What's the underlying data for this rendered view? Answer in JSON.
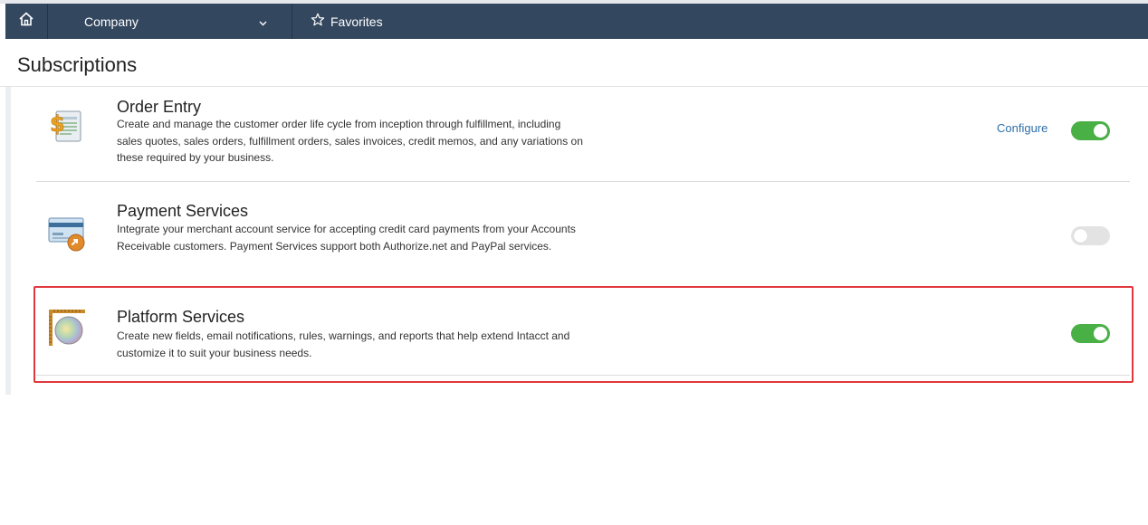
{
  "nav": {
    "home_icon": "home-icon",
    "company_label": "Company",
    "company_chevron_icon": "chevron-down-icon",
    "favorites_icon": "star-outline-icon",
    "favorites_label": "Favorites"
  },
  "page": {
    "title": "Subscriptions"
  },
  "subscriptions": [
    {
      "name": "Order Entry",
      "description": "Create and manage the customer order life cycle from inception through fulfillment, including sales quotes, sales orders, fulfillment orders, sales invoices, credit memos, and any variations on these required by your business.",
      "icon": "order-entry-icon",
      "configure_label": "Configure",
      "enabled": true
    },
    {
      "name": "Payment Services",
      "description": "Integrate your merchant account service for accepting credit card payments from your Accounts Receivable customers. Payment Services support both Authorize.net and PayPal services.",
      "icon": "payment-card-icon",
      "enabled": false
    },
    {
      "name": "Platform Services",
      "description": "Create new fields, email notifications, rules, warnings, and reports that help extend Intacct and customize it to suit your business needs.",
      "icon": "platform-services-icon",
      "enabled": true,
      "highlighted": true
    }
  ],
  "colors": {
    "nav_bg": "#33475f",
    "toggle_on": "#49b046",
    "toggle_off": "#e3e3e3",
    "link": "#2d6fa8",
    "highlight_border": "#e0383c"
  }
}
